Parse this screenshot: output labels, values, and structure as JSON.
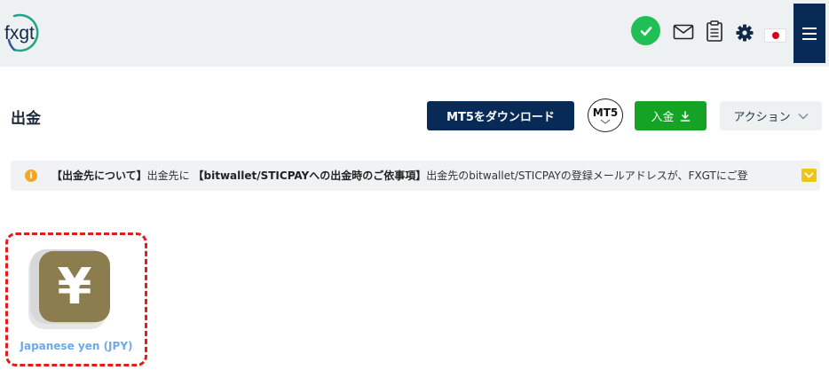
{
  "header": {
    "logo_text": "fxgt",
    "icons": [
      "check-icon",
      "mail-icon",
      "clipboard-icon",
      "gear-icon",
      "japan-flag-icon",
      "hamburger-menu-icon"
    ]
  },
  "page": {
    "title": "出金",
    "download_button": "MT5をダウンロード",
    "platform_badge": "MT5",
    "deposit_button": "入金",
    "action_button": "アクション"
  },
  "notice": {
    "part1": "【出金先について】",
    "part2": "出金先に",
    "part3": "【bitwallet/STICPAYへの出金時のご依事項】",
    "part4": "出金先のbitwallet/STICPAYの登録メールアドレスが、FXGTにご登"
  },
  "currency": {
    "symbol": "¥",
    "label": "Japanese yen (JPY)"
  },
  "colors": {
    "navy": "#072a56",
    "green": "#14a324",
    "yen_tile": "#8b7d4d",
    "highlight_border": "#e01e1e"
  }
}
